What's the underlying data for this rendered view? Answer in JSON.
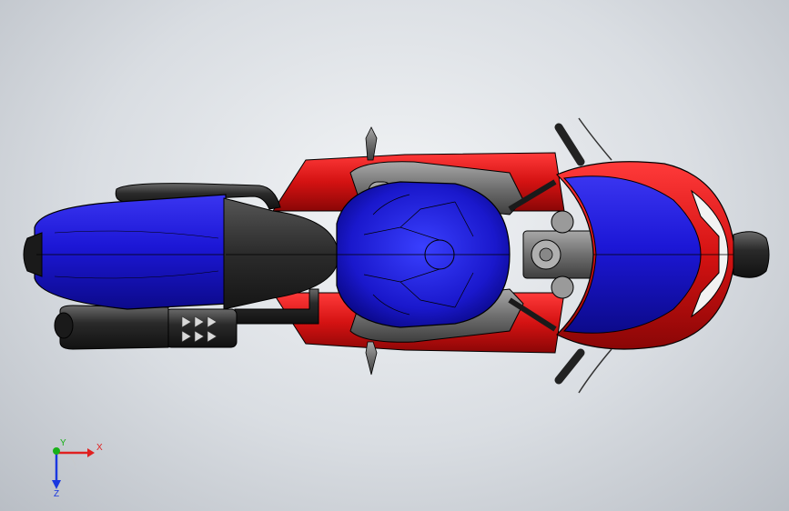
{
  "viewport": {
    "background_top": "#eef0f3",
    "background_bottom": "#b9bec5"
  },
  "model": {
    "colors": {
      "body_blue": "#1c17d6",
      "fairing_red": "#d41212",
      "seat_dark": "#2b2b2b",
      "frame_gray": "#6f6f6f",
      "chrome": "#9a9a9a"
    }
  },
  "triad": {
    "x_label": "X",
    "y_label": "Y",
    "z_label": "Z",
    "x_color": "#e02020",
    "y_color": "#18b018",
    "z_color": "#1a38e0"
  }
}
